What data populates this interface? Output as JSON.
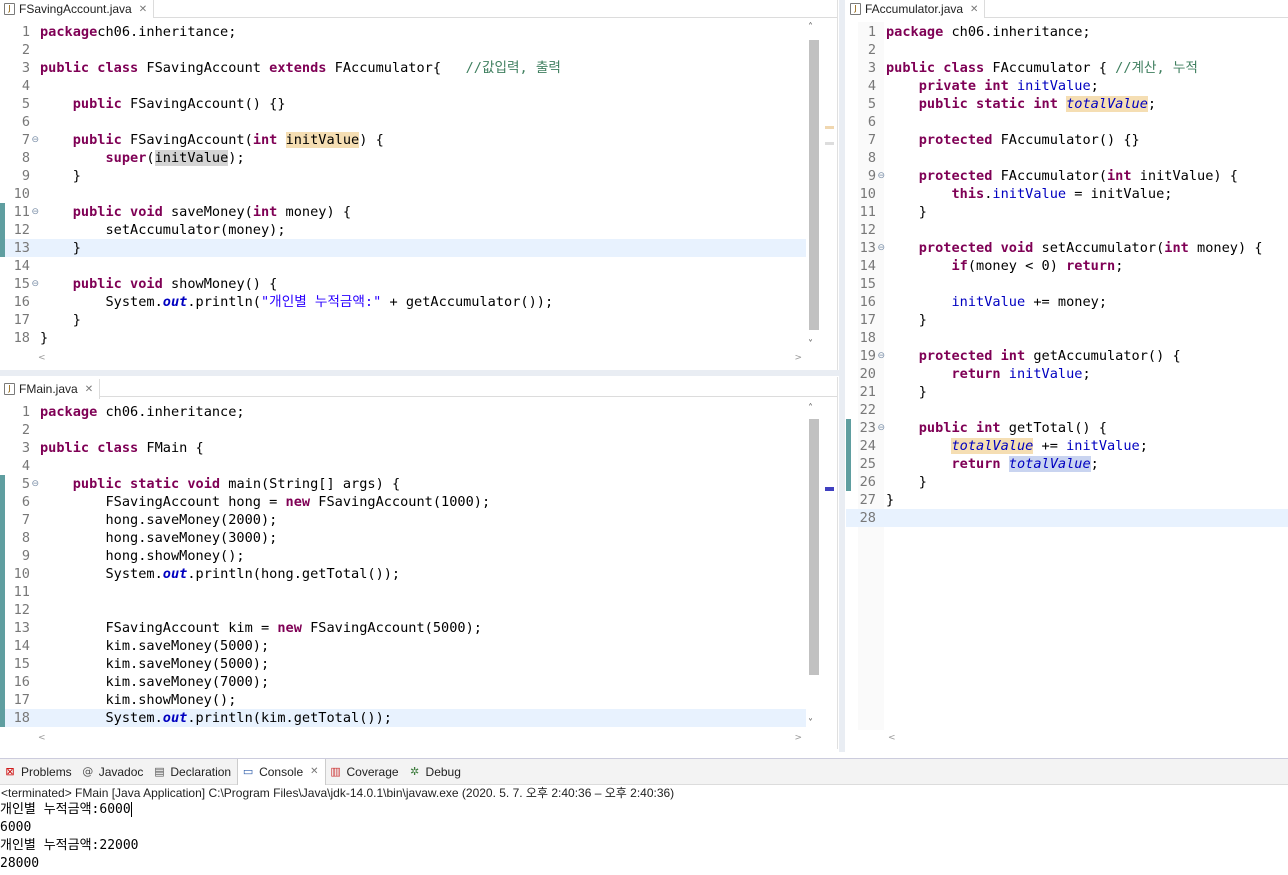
{
  "editors": {
    "saving": {
      "tab": "FSavingAccount.java",
      "lines": [
        [
          [
            "kw",
            "package"
          ],
          [
            "",
            "ch06.inheritance;"
          ]
        ],
        [],
        [
          [
            "kw",
            "public class"
          ],
          [
            "",
            " FSavingAccount "
          ],
          [
            "kw",
            "extends"
          ],
          [
            "",
            " FAccumulator{   "
          ],
          [
            "cm",
            "//값입력, 출력"
          ]
        ],
        [],
        [
          [
            "",
            "    "
          ],
          [
            "kw",
            "public"
          ],
          [
            "",
            " FSavingAccount() {}"
          ]
        ],
        [],
        [
          [
            "",
            "    "
          ],
          [
            "kw",
            "public"
          ],
          [
            "",
            " FSavingAccount("
          ],
          [
            "kw",
            "int"
          ],
          [
            "",
            " "
          ],
          [
            "occ",
            "initValue"
          ],
          [
            "",
            ") {"
          ]
        ],
        [
          [
            "",
            "        "
          ],
          [
            "kw",
            "super"
          ],
          [
            "",
            "("
          ],
          [
            "ref",
            "initValue"
          ],
          [
            "",
            ");"
          ]
        ],
        [
          [
            "",
            "    }"
          ]
        ],
        [],
        [
          [
            "",
            "    "
          ],
          [
            "kw",
            "public void"
          ],
          [
            "",
            " saveMoney("
          ],
          [
            "kw",
            "int"
          ],
          [
            "",
            " money) {"
          ]
        ],
        [
          [
            "",
            "        setAccumulator(money);"
          ]
        ],
        [
          [
            "",
            "    }"
          ]
        ],
        [],
        [
          [
            "",
            "    "
          ],
          [
            "kw",
            "public void"
          ],
          [
            "",
            " showMoney() {"
          ]
        ],
        [
          [
            "",
            "        System."
          ],
          [
            "sf",
            "out"
          ],
          [
            "",
            ".println("
          ],
          [
            "st",
            "\"개인별 누적금액:\""
          ],
          [
            "",
            " + getAccumulator());"
          ]
        ],
        [
          [
            "",
            "    }"
          ]
        ],
        [
          [
            "",
            "}"
          ]
        ]
      ]
    },
    "main": {
      "tab": "FMain.java",
      "lines": [
        [
          [
            "kw",
            "package"
          ],
          [
            "",
            " ch06.inheritance;"
          ]
        ],
        [],
        [
          [
            "kw",
            "public class"
          ],
          [
            "",
            " FMain {"
          ]
        ],
        [],
        [
          [
            "",
            "    "
          ],
          [
            "kw",
            "public static void"
          ],
          [
            "",
            " main(String[] args) {"
          ]
        ],
        [
          [
            "",
            "        FSavingAccount hong = "
          ],
          [
            "kw",
            "new"
          ],
          [
            "",
            " FSavingAccount(1000);"
          ]
        ],
        [
          [
            "",
            "        hong.saveMoney(2000);"
          ]
        ],
        [
          [
            "",
            "        hong.saveMoney(3000);"
          ]
        ],
        [
          [
            "",
            "        hong.showMoney();"
          ]
        ],
        [
          [
            "",
            "        System."
          ],
          [
            "sf",
            "out"
          ],
          [
            "",
            ".println(hong.getTotal());"
          ]
        ],
        [],
        [],
        [
          [
            "",
            "        FSavingAccount kim = "
          ],
          [
            "kw",
            "new"
          ],
          [
            "",
            " FSavingAccount(5000);"
          ]
        ],
        [
          [
            "",
            "        kim.saveMoney(5000);"
          ]
        ],
        [
          [
            "",
            "        kim.saveMoney(5000);"
          ]
        ],
        [
          [
            "",
            "        kim.saveMoney(7000);"
          ]
        ],
        [
          [
            "",
            "        kim.showMoney();"
          ]
        ],
        [
          [
            "",
            "        System."
          ],
          [
            "sf",
            "out"
          ],
          [
            "",
            ".println(kim.getTotal());"
          ]
        ]
      ]
    },
    "accum": {
      "tab": "FAccumulator.java",
      "lines": [
        [
          [
            "kw",
            "package"
          ],
          [
            "",
            " ch06.inheritance;"
          ]
        ],
        [],
        [
          [
            "kw",
            "public class"
          ],
          [
            "",
            " FAccumulator { "
          ],
          [
            "cm",
            "//계산, 누적"
          ]
        ],
        [
          [
            "",
            "    "
          ],
          [
            "kw",
            "private int"
          ],
          [
            "",
            " "
          ],
          [
            "fd",
            "initValue"
          ],
          [
            "",
            ";"
          ]
        ],
        [
          [
            "",
            "    "
          ],
          [
            "kw",
            "public static int"
          ],
          [
            "",
            " "
          ],
          [
            "stfocc",
            "totalValue"
          ],
          [
            "",
            ";"
          ]
        ],
        [],
        [
          [
            "",
            "    "
          ],
          [
            "kw",
            "protected"
          ],
          [
            "",
            " FAccumulator() {}"
          ]
        ],
        [],
        [
          [
            "",
            "    "
          ],
          [
            "kw",
            "protected"
          ],
          [
            "",
            " FAccumulator("
          ],
          [
            "kw",
            "int"
          ],
          [
            "",
            " initValue) {"
          ]
        ],
        [
          [
            "",
            "        "
          ],
          [
            "kw",
            "this"
          ],
          [
            "",
            "."
          ],
          [
            "fd",
            "initValue"
          ],
          [
            "",
            " = initValue;"
          ]
        ],
        [
          [
            "",
            "    }"
          ]
        ],
        [],
        [
          [
            "",
            "    "
          ],
          [
            "kw",
            "protected void"
          ],
          [
            "",
            " setAccumulator("
          ],
          [
            "kw",
            "int"
          ],
          [
            "",
            " money) {"
          ]
        ],
        [
          [
            "",
            "        "
          ],
          [
            "kw",
            "if"
          ],
          [
            "",
            "(money < 0) "
          ],
          [
            "kw",
            "return"
          ],
          [
            "",
            ";"
          ]
        ],
        [],
        [
          [
            "",
            "        "
          ],
          [
            "fd",
            "initValue"
          ],
          [
            "",
            " += money;"
          ]
        ],
        [
          [
            "",
            "    }"
          ]
        ],
        [],
        [
          [
            "",
            "    "
          ],
          [
            "kw",
            "protected int"
          ],
          [
            "",
            " getAccumulator() {"
          ]
        ],
        [
          [
            "",
            "        "
          ],
          [
            "kw",
            "return"
          ],
          [
            "",
            " "
          ],
          [
            "fd",
            "initValue"
          ],
          [
            "",
            ";"
          ]
        ],
        [
          [
            "",
            "    }"
          ]
        ],
        [],
        [
          [
            "",
            "    "
          ],
          [
            "kw",
            "public int"
          ],
          [
            "",
            " getTotal() {"
          ]
        ],
        [
          [
            "",
            "        "
          ],
          [
            "stfocc",
            "totalValue"
          ],
          [
            "",
            " += "
          ],
          [
            "fd",
            "initValue"
          ],
          [
            "",
            ";"
          ]
        ],
        [
          [
            "",
            "        "
          ],
          [
            "kw",
            "return"
          ],
          [
            "",
            " "
          ],
          [
            "stfocc2",
            "totalValue"
          ],
          [
            "",
            ";"
          ]
        ],
        [
          [
            "",
            "    }"
          ]
        ],
        [
          [
            "",
            "}"
          ]
        ],
        []
      ]
    }
  },
  "console": {
    "tabs": [
      "Problems",
      "Javadoc",
      "Declaration",
      "Console",
      "Coverage",
      "Debug"
    ],
    "terminated": "<terminated> FMain [Java Application] C:\\Program Files\\Java\\jdk-14.0.1\\bin\\javaw.exe  (2020. 5. 7. 오후 2:40:36 – 오후 2:40:36)",
    "output": [
      "개인별 누적금액:6000",
      "6000",
      "개인별 누적금액:22000",
      "28000"
    ]
  }
}
